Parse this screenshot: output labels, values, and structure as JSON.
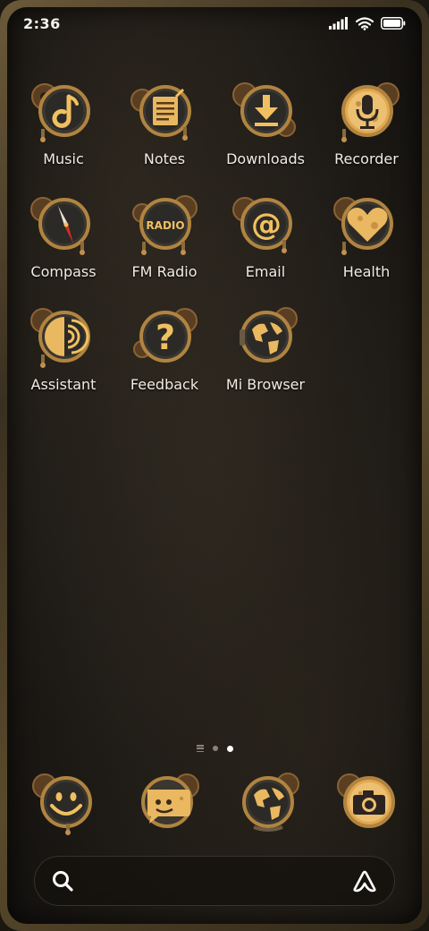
{
  "status_bar": {
    "time": "2:36",
    "icons": [
      "signal-icon",
      "wifi-icon",
      "battery-icon"
    ]
  },
  "apps": [
    {
      "label": "Music",
      "icon": "music-note-icon"
    },
    {
      "label": "Notes",
      "icon": "notes-icon"
    },
    {
      "label": "Downloads",
      "icon": "download-arrow-icon"
    },
    {
      "label": "Recorder",
      "icon": "microphone-icon"
    },
    {
      "label": "Compass",
      "icon": "compass-icon"
    },
    {
      "label": "FM Radio",
      "icon": "radio-icon",
      "badge_text": "RADIO"
    },
    {
      "label": "Email",
      "icon": "at-sign-icon"
    },
    {
      "label": "Health",
      "icon": "heart-icon"
    },
    {
      "label": "Assistant",
      "icon": "assistant-icon"
    },
    {
      "label": "Feedback",
      "icon": "question-mark-icon"
    },
    {
      "label": "Mi Browser",
      "icon": "globe-icon"
    }
  ],
  "pager": {
    "pages": 2,
    "active": 1
  },
  "dock": [
    {
      "icon": "smiley-icon",
      "name": "dock-smiley"
    },
    {
      "icon": "chat-bubble-icon",
      "name": "dock-messages"
    },
    {
      "icon": "globe-icon",
      "name": "dock-browser"
    },
    {
      "icon": "camera-icon",
      "name": "dock-camera"
    }
  ],
  "search": {
    "left_icon": "search-icon",
    "right_icon": "assistant-a-icon"
  },
  "colors": {
    "gold": "#e0b25a",
    "bronze": "#6b4a2a",
    "background": "#1b1814"
  }
}
